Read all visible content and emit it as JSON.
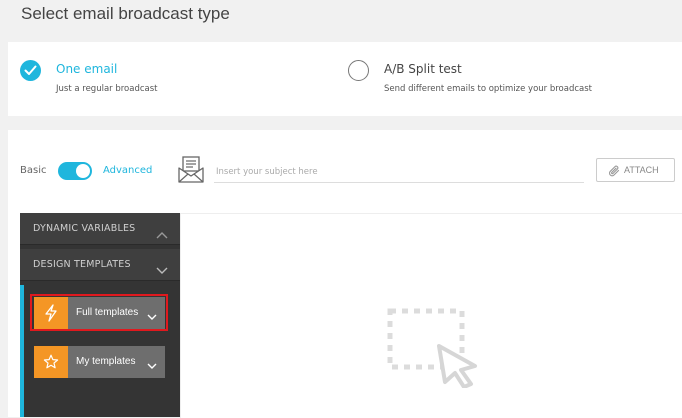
{
  "header": {
    "title": "Select email broadcast type"
  },
  "broadcast_types": [
    {
      "title": "One email",
      "description": "Just a regular broadcast",
      "selected": true
    },
    {
      "title": "A/B Split test",
      "description": "Send different emails to optimize your broadcast",
      "selected": false
    }
  ],
  "editor_mode": {
    "basic_label": "Basic",
    "advanced_label": "Advanced",
    "advanced_on": true
  },
  "subject": {
    "placeholder": "Insert your subject here",
    "value": "",
    "icon": "envelope-doc-icon"
  },
  "attach": {
    "label": "ATTACH",
    "icon": "paperclip-icon"
  },
  "sidebar": {
    "sections": [
      {
        "label": "DYNAMIC VARIABLES",
        "chevron": "up"
      },
      {
        "label": "DESIGN TEMPLATES",
        "chevron": "down"
      }
    ],
    "templates": [
      {
        "label": "Full templates",
        "icon": "lightning-icon",
        "highlighted": true
      },
      {
        "label": "My templates",
        "icon": "star-icon",
        "highlighted": false
      }
    ]
  },
  "canvas": {
    "placeholder_icon": "drag-drop-icon"
  },
  "colors": {
    "accent": "#1fb6dd",
    "template_icon": "#f49625",
    "highlight": "#e0191e",
    "sidebar": "#343434"
  }
}
